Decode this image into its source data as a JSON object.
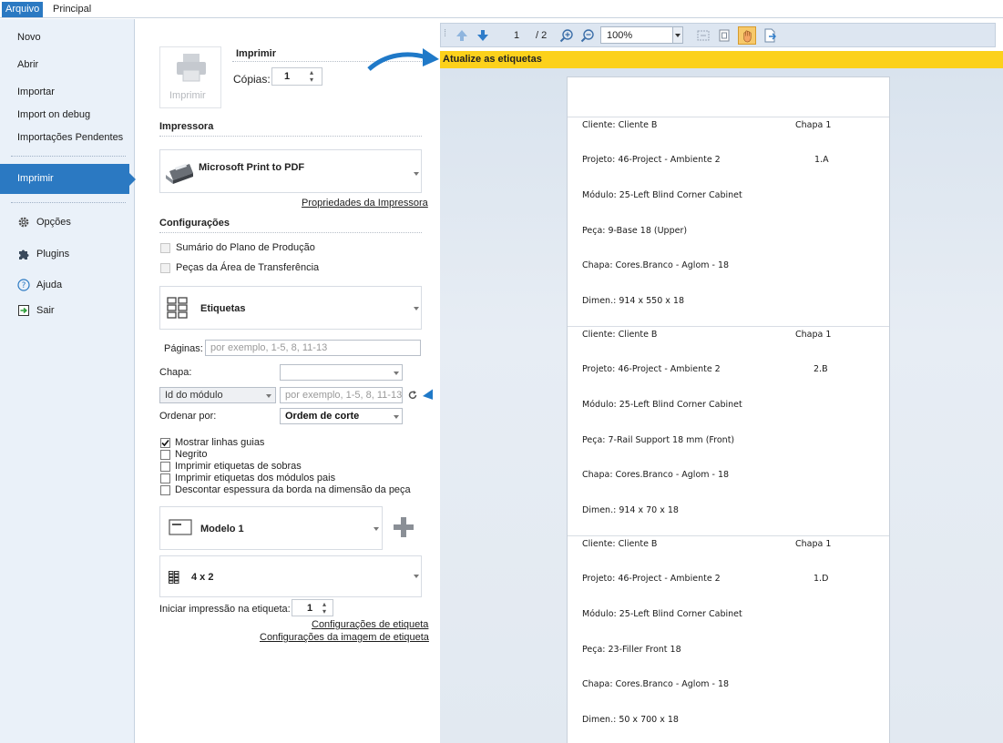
{
  "ribbon": {
    "tabs": [
      {
        "label": "Arquivo"
      },
      {
        "label": "Principal"
      }
    ]
  },
  "nav": {
    "items": [
      {
        "label": "Novo"
      },
      {
        "label": "Abrir"
      },
      {
        "label": "Importar"
      },
      {
        "label": "Import on debug"
      },
      {
        "label": "Importações Pendentes"
      }
    ],
    "selected": "Imprimir",
    "bottom": [
      {
        "label": "Opções",
        "icon": "gear-icon"
      },
      {
        "label": "Plugins",
        "icon": "puzzle-icon"
      },
      {
        "label": "Ajuda",
        "icon": "help-icon"
      },
      {
        "label": "Sair",
        "icon": "exit-icon"
      }
    ]
  },
  "print": {
    "title": "Imprimir",
    "button_label": "Imprimir",
    "copies_label": "Cópias:",
    "copies_value": "1"
  },
  "printer": {
    "section": "Impressora",
    "name": "Microsoft Print to PDF",
    "properties_link": "Propriedades da Impressora"
  },
  "config": {
    "section": "Configurações",
    "checkboxes": [
      {
        "label": "Sumário do Plano de Produção",
        "checked": false
      },
      {
        "label": "Peças da Área de Transferência",
        "checked": false
      }
    ],
    "report": "Etiquetas",
    "pages_label": "Páginas:",
    "pages_placeholder": "por exemplo, 1-5, 8, 11-13",
    "chapa_label": "Chapa:",
    "chapa_value": "",
    "module_select": "Id do módulo",
    "module_placeholder": "por exemplo, 1-5, 8, 11-13",
    "order_label": "Ordenar por:",
    "order_value": "Ordem de corte",
    "options": [
      {
        "label": "Mostrar linhas guias",
        "checked": true
      },
      {
        "label": "Negrito",
        "checked": false
      },
      {
        "label": "Imprimir etiquetas de sobras",
        "checked": false
      },
      {
        "label": "Imprimir etiquetas dos módulos pais",
        "checked": false
      },
      {
        "label": "Descontar espessura da borda na dimensão da peça",
        "checked": false
      }
    ],
    "model": "Modelo 1",
    "layout": "4 x 2",
    "start_label": "Iniciar impressão na etiqueta:",
    "start_value": "1",
    "label_settings_link": "Configurações de etiqueta",
    "image_settings_link": "Configurações da imagem de etiqueta"
  },
  "preview": {
    "page_current": "1",
    "page_total": "/ 2",
    "zoom": "100%",
    "banner": "Atualize as etiquetas",
    "labels": [
      {
        "cliente": "Cliente: Cliente B",
        "chapa_num": "Chapa 1",
        "projeto": "Projeto: 46-Project - Ambiente 2",
        "id": "1.A",
        "modulo": "Módulo: 25-Left Blind Corner Cabinet",
        "peca": "Peça: 9-Base 18 (Upper)",
        "chapa": "Chapa: Cores.Branco - Aglom - 18",
        "dimen": "Dimen.: 914 x 550 x 18"
      },
      {
        "cliente": "Cliente: Cliente B",
        "chapa_num": "Chapa 1",
        "projeto": "Projeto: 46-Project - Ambiente 2",
        "id": "2.B",
        "modulo": "Módulo: 25-Left Blind Corner Cabinet",
        "peca": "Peça: 7-Rail Support 18 mm (Front)",
        "chapa": "Chapa: Cores.Branco - Aglom - 18",
        "dimen": "Dimen.: 914 x 70 x 18"
      },
      {
        "cliente": "Cliente: Cliente B",
        "chapa_num": "Chapa 1",
        "projeto": "Projeto: 46-Project - Ambiente 2",
        "id": "1.D",
        "modulo": "Módulo: 25-Left Blind Corner Cabinet",
        "peca": "Peça: 23-Filler Front 18",
        "chapa": "Chapa: Cores.Branco - Aglom - 18",
        "dimen": "Dimen.: 50 x 700 x 18"
      }
    ]
  },
  "colors": {
    "accent": "#2b79c2",
    "banner": "#fcd11b",
    "nav_bg": "#eaf1f9"
  }
}
